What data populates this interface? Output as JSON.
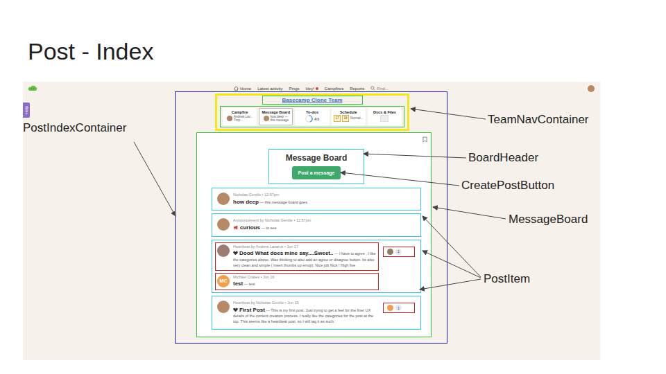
{
  "slide": {
    "title": "Post - Index"
  },
  "app": {
    "help": "Help",
    "user": {
      "color": "#b88a62"
    },
    "nav": [
      {
        "label": "Home",
        "kind": "home",
        "unread": false
      },
      {
        "label": "Latest activity",
        "kind": "link",
        "unread": false
      },
      {
        "label": "Pings",
        "kind": "link",
        "unread": false
      },
      {
        "label": "Hey!",
        "kind": "link",
        "unread": true
      },
      {
        "label": "Campfires",
        "kind": "link",
        "unread": false
      },
      {
        "label": "Reports",
        "kind": "link",
        "unread": false
      },
      {
        "label": "Find...",
        "kind": "search",
        "unread": false
      }
    ]
  },
  "team": {
    "name": "Basecamp Clone Team",
    "tools": [
      {
        "kind": "campfire",
        "title": "Campfire",
        "selected": false,
        "lines": [
          "Andrew Lav...",
          "Tmp..."
        ],
        "color": "#a9806a"
      },
      {
        "kind": "board",
        "title": "Message Board",
        "selected": true,
        "lines": [
          "how deep —",
          "this message"
        ],
        "color": "#b58b67"
      },
      {
        "kind": "todos",
        "title": "To-dos",
        "selected": false,
        "reading": "4/9",
        "level": 0.44
      },
      {
        "kind": "schedule",
        "title": "Schedule",
        "selected": false,
        "days": [
          "17",
          "18"
        ],
        "lines": [
          "Normal..."
        ]
      },
      {
        "kind": "docs",
        "title": "Docs & Files",
        "selected": false
      }
    ]
  },
  "board": {
    "title": "Message Board",
    "button": "Post a message"
  },
  "posts": [
    {
      "kind": "plain",
      "meta": "Nicholas Gentile • 12:57pm",
      "title": "how deep",
      "excerpt": "— this message board goes",
      "color": "#b68a66",
      "outlined": false,
      "replies": []
    },
    {
      "kind": "announcement",
      "meta": "Announcement by Nicholas Gentile • 12:57pm",
      "title": "curious",
      "excerpt": "— to see",
      "color": "#b68a66",
      "outlined": false,
      "replies": []
    },
    {
      "kind": "heartbeat",
      "meta": "Heartbeat by Andrew Lazarus • Jun 17",
      "title": "Dood What does mine say....Sweet..",
      "excerpt": "— I have to agree , I like the categories above. Was thinking to also add an agree or disagree button. Its also very clean and simple ( insert thumbs up emoji). Nice job Nick ! High five",
      "color": "#9c7b72",
      "outlined": true,
      "response": {
        "count": "1",
        "color": "#8f7a66"
      },
      "replies": [
        {
          "kind": "plain",
          "meta": "Michael Coates • Jun 16",
          "title": "test",
          "excerpt": "— test",
          "initials": "MC",
          "color": "#f0a04b",
          "outlined": true
        }
      ]
    },
    {
      "kind": "heartbeat",
      "meta": "Heartbeat by Nicholas Gentile • Jun 15",
      "title": "First Post",
      "excerpt": "— This is my first post. Just trying to get a feel for the finer UX details of the content creation process. I really like the categories for the post at the top. This seems like a heartbeat post, so I will tag it as such.",
      "color": "#b68a66",
      "outlined": false,
      "response": {
        "count": "1",
        "color": "#f0a04b"
      },
      "replies": []
    }
  ],
  "annotations": [
    {
      "label": "PostIndexContainer"
    },
    {
      "label": "TeamNavContainer"
    },
    {
      "label": "BoardHeader"
    },
    {
      "label": "CreatePostButton"
    },
    {
      "label": "MessageBoard"
    },
    {
      "label": "PostItem"
    }
  ]
}
